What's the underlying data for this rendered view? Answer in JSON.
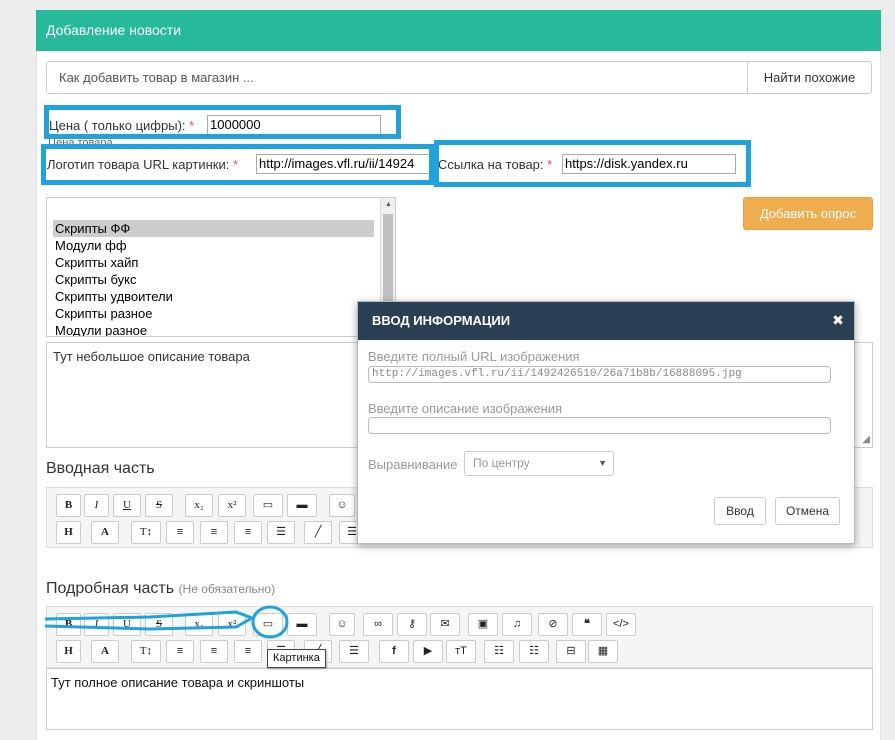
{
  "header": {
    "title": "Добавление новости"
  },
  "search": {
    "value": "Как добавить товар в магазин ...",
    "button_label": "Найти похожие"
  },
  "price": {
    "label": "Цена ( только цифры):",
    "required_mark": "*",
    "value": "1000000",
    "hint": "Цена товара"
  },
  "logo": {
    "label": "Логотип товара URL картинки:",
    "required_mark": "*",
    "value": "http://images.vfl.ru/ii/14924"
  },
  "link": {
    "label": "Ссылка на товар:",
    "required_mark": "*",
    "value": "https://disk.yandex.ru"
  },
  "add_poll_button": "Добавить опрос",
  "categories": {
    "items": [
      "Скрипты ФФ",
      "Модули фф",
      "Скрипты хайп",
      "Скрипты букс",
      "Скрипты удвоители",
      "Скрипты разное",
      "Модули разное"
    ],
    "selected_index": 0
  },
  "short_description": "Тут небольшое описание товара",
  "intro": {
    "title": "Вводная часть"
  },
  "details": {
    "title": "Подробная часть",
    "optional_note": "(Не обязательно)",
    "body": "Тут полное описание товара и скриншоты"
  },
  "toolbar": {
    "row1": [
      "B",
      "I",
      "U",
      "S",
      "x₂",
      "x²",
      "image-icon",
      "folder-icon",
      "smiley-icon",
      "link-icon",
      "key-icon",
      "mail-icon",
      "video-icon",
      "music-icon",
      "hide-icon",
      "quote-icon",
      "code-icon"
    ],
    "row2": [
      "H",
      "A",
      "T↕",
      "align-left-icon",
      "align-center-icon",
      "align-right-icon",
      "justify-icon",
      "brush-icon",
      "list-icon",
      "facebook-icon",
      "youtube-icon",
      "typography-icon",
      "bullet-list-icon",
      "numbered-list-icon",
      "page-break-icon",
      "table-icon"
    ]
  },
  "tooltip": "Картинка",
  "modal": {
    "title": "ВВОД ИНФОРМАЦИИ",
    "url_label": "Введите полный URL изображения",
    "url_value": "http://images.vfl.ru/ii/1492426510/26a71b8b/16888095.jpg",
    "desc_label": "Введите описание изображения",
    "desc_value": "",
    "align_label": "Выравнивание",
    "align_value": "По центру",
    "ok_label": "Ввод",
    "cancel_label": "Отмена"
  },
  "colors": {
    "header": "#26b99a",
    "highlight": "#1ea3dd",
    "orange": "#f0ad4e",
    "modal_head": "#2a3f54"
  }
}
